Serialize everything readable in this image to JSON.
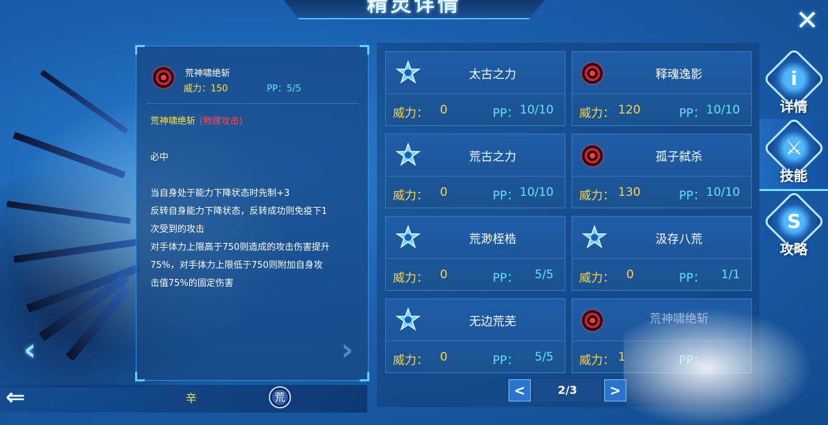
{
  "header": {
    "title": "精灵详情"
  },
  "close_glyph": "✕",
  "detail": {
    "skill_name": "荒神啸绝斩",
    "power_label": "威力：150",
    "pp_label": "PP：5/5",
    "name_line": "荒神啸绝斩",
    "category": "(物理攻击)",
    "desc_lines": [
      "必中",
      "当自身处于能力下降状态时先制+3",
      "反转自身能力下降状态，反转成功则免疫下1",
      "次受到的攻击",
      "对手体力上限高于750则造成的攻击伤害提升",
      "75%，对手体力上限低于750则附加自身攻",
      "击值75%的固定伤害"
    ],
    "icon": "red-vortex-icon"
  },
  "nav": {
    "left_glyph": "‹",
    "right_glyph": "›",
    "back_glyph": "⇐"
  },
  "attributes": {
    "attr_text": "辛",
    "badge_text": "荒"
  },
  "labels": {
    "power": "威力：",
    "pp": "PP："
  },
  "skills": [
    {
      "name": "太古之力",
      "power": "0",
      "pp": "10/10",
      "icon": "blue-star-icon"
    },
    {
      "name": "释魂逸影",
      "power": "120",
      "pp": "10/10",
      "icon": "red-vortex-icon"
    },
    {
      "name": "荒古之力",
      "power": "0",
      "pp": "10/10",
      "icon": "blue-star-icon"
    },
    {
      "name": "孤子弑杀",
      "power": "130",
      "pp": "10/10",
      "icon": "red-vortex-icon"
    },
    {
      "name": "荒渺桎梏",
      "power": "0",
      "pp": "5/5",
      "icon": "blue-star-icon"
    },
    {
      "name": "汲存八荒",
      "power": "0",
      "pp": "1/1",
      "icon": "blue-star-icon"
    },
    {
      "name": "无边荒芜",
      "power": "0",
      "pp": "5/5",
      "icon": "blue-star-icon"
    },
    {
      "name": "荒神啸绝斩",
      "power": "1",
      "pp": "",
      "icon": "red-vortex-icon"
    }
  ],
  "pager": {
    "indicator": "2/3",
    "prev_glyph": "<",
    "next_glyph": ">"
  },
  "side_tabs": [
    {
      "label": "详情",
      "glyph": "i",
      "icon": "info-icon"
    },
    {
      "label": "技能",
      "glyph": "⚔",
      "icon": "crossed-swords-icon"
    },
    {
      "label": "攻略",
      "glyph": "S",
      "icon": "strategy-book-icon"
    }
  ],
  "colors": {
    "accent": "#5fe3ff",
    "power": "#ffd54a",
    "physical": "#ff4c4c"
  }
}
